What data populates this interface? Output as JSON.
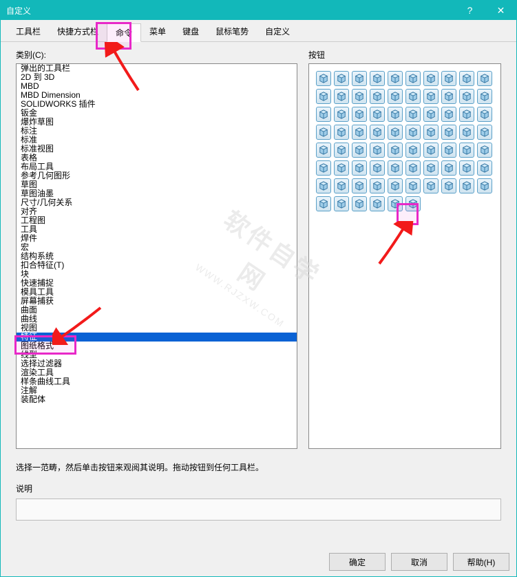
{
  "window": {
    "title": "自定义",
    "help_glyph": "?",
    "close_glyph": "✕"
  },
  "tabs": {
    "items": [
      {
        "label": "工具栏"
      },
      {
        "label": "快捷方式栏"
      },
      {
        "label": "命令",
        "active": true
      },
      {
        "label": "菜单"
      },
      {
        "label": "键盘"
      },
      {
        "label": "鼠标笔势"
      },
      {
        "label": "自定义"
      }
    ]
  },
  "labels": {
    "categories": "类别(C):",
    "buttons": "按钮",
    "description": "说明"
  },
  "instruction": "选择一范畴，然后单击按钮来观阅其说明。拖动按钮到任何工具栏。",
  "categories": [
    "弹出的工具栏",
    "2D 到 3D",
    "MBD",
    "MBD Dimension",
    "SOLIDWORKS 插件",
    "钣金",
    "爆炸草图",
    "标注",
    "标准",
    "标准视图",
    "表格",
    "布局工具",
    "参考几何图形",
    "草图",
    "草图油墨",
    "尺寸/几何关系",
    "对齐",
    "工程图",
    "工具",
    "焊件",
    "宏",
    "结构系统",
    "扣合特征(T)",
    "块",
    "快速捕捉",
    "模具工具",
    "屏幕捕获",
    "曲面",
    "曲线",
    "视图",
    "特征",
    "图纸格式",
    "线型",
    "选择过滤器",
    "渲染工具",
    "样条曲线工具",
    "注解",
    "装配体"
  ],
  "selected_index": 30,
  "buttons_palette": {
    "count": 76,
    "icons": [
      "cube",
      "swirl",
      "hook",
      "trapezoid",
      "loft",
      "block",
      "wedge",
      "taper",
      "shell",
      "pipe",
      "half-cylinder",
      "prism",
      "diamond",
      "cube-lock",
      "cube-star",
      "cube-ring",
      "trim",
      "faceted",
      "cube-dot",
      "cube-face",
      "house",
      "cylinder",
      "washer",
      "cube-gear",
      "orbit",
      "copy",
      "cube-cube",
      "tube",
      "dome",
      "hemi",
      "egg",
      "sphere-grid",
      "tube-grid",
      "can",
      "sphere-shell",
      "equal",
      "H",
      "ruler",
      "down",
      "square",
      "rotate",
      "frame",
      "cross",
      "corner",
      "snap-h",
      "arrows",
      "tree",
      "grid",
      "target",
      "box-down",
      "box-side",
      "box-up",
      "box-diag",
      "box-flat",
      "box-grid",
      "box-lines",
      "shape",
      "cube-yellow",
      "flag",
      "cube-cut",
      "sphere-cut",
      "cube-slice",
      "check",
      "3d-label",
      "3d-split",
      "box-4",
      "wave",
      "fold"
    ]
  },
  "footer": {
    "ok": "确定",
    "cancel": "取消",
    "help": "帮助(H)"
  },
  "watermark": {
    "big": "软件自学网",
    "small": "WWW.RJZXW.COM"
  },
  "annotations": {
    "tab_highlight": "命令 tab circled magenta",
    "list_highlight": "特征 list item circled magenta",
    "icon_highlight": "fold icon circled magenta",
    "arrow1": "red arrow from near top pointing to tab",
    "arrow2": "red arrow pointing to 特征",
    "arrow3": "red arrow pointing to highlighted icon"
  }
}
